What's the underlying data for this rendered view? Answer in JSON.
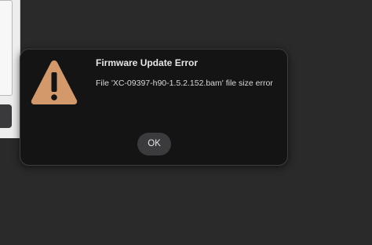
{
  "dialog": {
    "title": "Firmware Update Error",
    "message": "File 'XC-09397-h90-1.5.2.152.bam' file size error",
    "ok_label": "OK",
    "icon": "warning-icon"
  },
  "colors": {
    "background": "#2a2a2b",
    "dialog_background": "#141414",
    "warning_icon": "#d4996a",
    "button_background": "#3b3b3d"
  }
}
